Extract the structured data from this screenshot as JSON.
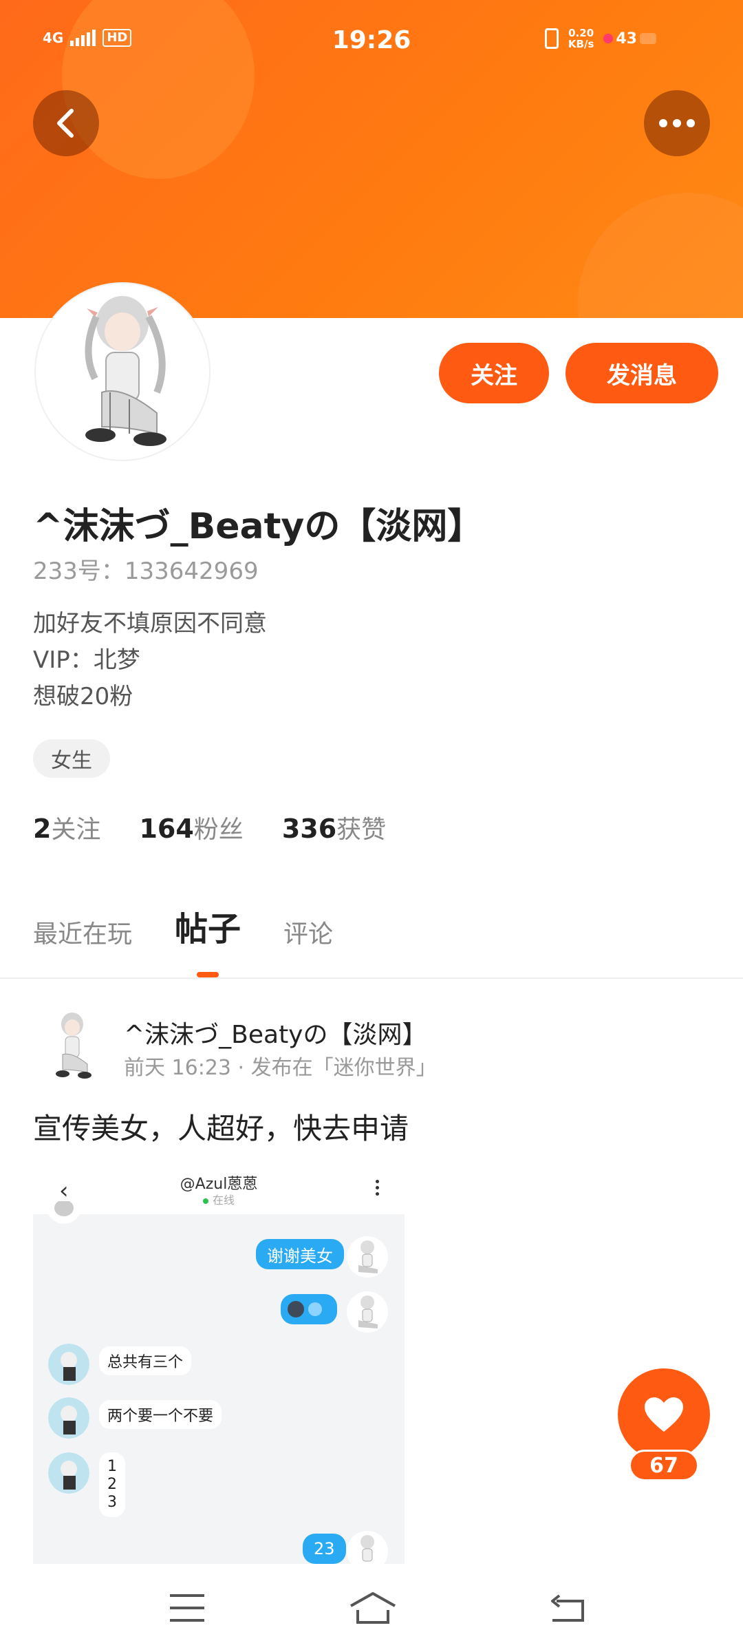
{
  "status_bar": {
    "network": "4G",
    "hd": "HD",
    "time": "19:26",
    "speed_value": "0.20",
    "speed_unit": "KB/s",
    "battery": "43"
  },
  "profile": {
    "name": "^沫沫づ_Beatyの【淡网】",
    "id_text": "233号：133642969",
    "bio": [
      "加好友不填原因不同意",
      "VIP：北梦",
      "想破20粉"
    ],
    "gender_tag": "女生",
    "follow_label": "关注",
    "message_label": "发消息",
    "stats": [
      {
        "num": "2",
        "label": "关注"
      },
      {
        "num": "164",
        "label": "粉丝"
      },
      {
        "num": "336",
        "label": "获赞"
      }
    ]
  },
  "tabs": [
    {
      "label": "最近在玩",
      "active": false
    },
    {
      "label": "帖子",
      "active": true
    },
    {
      "label": "评论",
      "active": false
    }
  ],
  "post": {
    "author": "^沫沫づ_Beatyの【淡网】",
    "meta": "前天 16:23 · 发布在「迷你世界」",
    "text": "宣传美女，人超好，快去申请",
    "screenshot": {
      "title": "@Azul蒽蒽",
      "status": "在线",
      "msg_thanks": "谢谢美女",
      "msg_total": "总共有三个",
      "msg_two": "两个要一个不要",
      "msg_list": [
        "1",
        "2",
        "3"
      ],
      "msg_reply": "23"
    }
  },
  "like_count": "67",
  "icons": {
    "back": "back-arrow-icon",
    "more": "more-dots-icon",
    "heart": "heart-icon",
    "menu": "menu-icon",
    "home": "home-icon",
    "return": "return-icon"
  },
  "colors": {
    "accent": "#ff5a12",
    "banner": "#ff7a10",
    "chat_blue": "#29aaf2"
  }
}
